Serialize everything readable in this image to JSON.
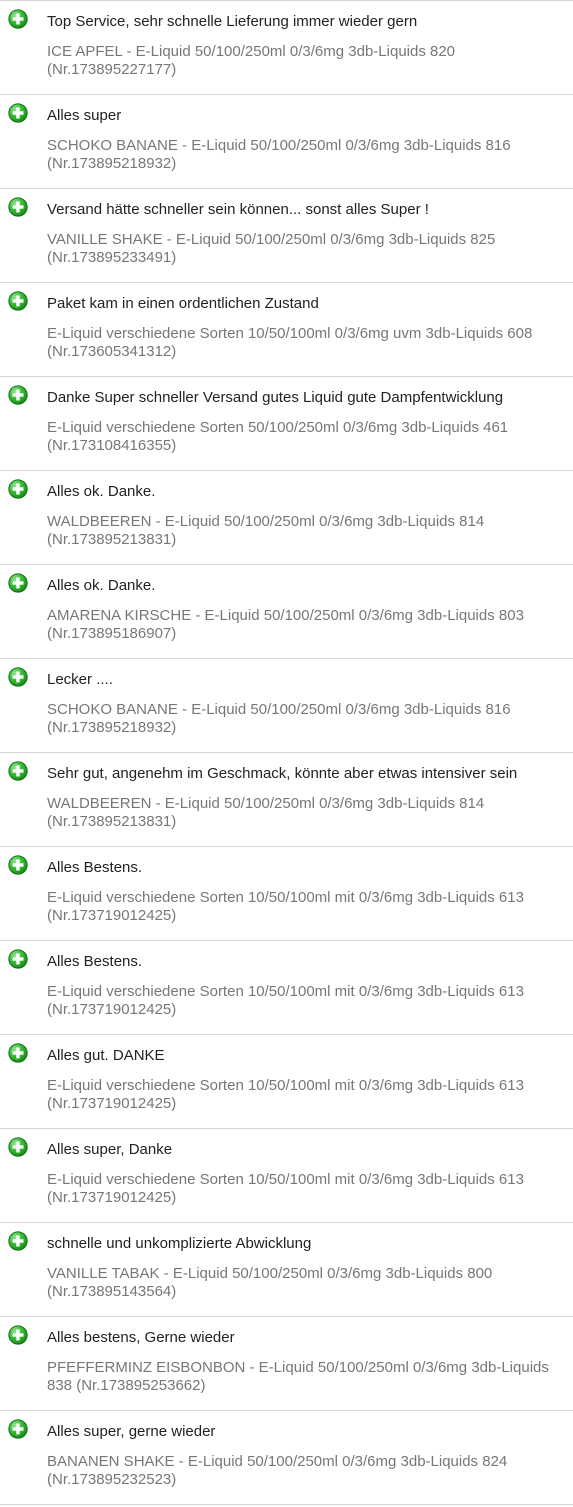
{
  "colors": {
    "positive_icon": "#22aa22",
    "comment_text": "#222222",
    "product_text": "#777777",
    "divider": "#d4d4d4"
  },
  "feedback": [
    {
      "icon": "positive-plus-icon",
      "comment": "Top Service, sehr schnelle Lieferung immer wieder gern",
      "product": "ICE APFEL - E-Liquid 50/100/250ml 0/3/6mg 3db-Liquids 820 (Nr.173895227177)"
    },
    {
      "icon": "positive-plus-icon",
      "comment": "Alles super",
      "product": "SCHOKO BANANE - E-Liquid 50/100/250ml 0/3/6mg 3db-Liquids 816 (Nr.173895218932)"
    },
    {
      "icon": "positive-plus-icon",
      "comment": "Versand hätte schneller sein können... sonst alles Super !",
      "product": "VANILLE SHAKE - E-Liquid 50/100/250ml 0/3/6mg 3db-Liquids 825 (Nr.173895233491)"
    },
    {
      "icon": "positive-plus-icon",
      "comment": "Paket kam in einen ordentlichen Zustand",
      "product": "E-Liquid verschiedene Sorten 10/50/100ml 0/3/6mg uvm 3db-Liquids 608 (Nr.173605341312)"
    },
    {
      "icon": "positive-plus-icon",
      "comment": "Danke Super schneller Versand gutes Liquid gute Dampfentwicklung",
      "product": "E-Liquid verschiedene Sorten 50/100/250ml 0/3/6mg 3db-Liquids 461 (Nr.173108416355)"
    },
    {
      "icon": "positive-plus-icon",
      "comment": "Alles ok. Danke.",
      "product": "WALDBEEREN - E-Liquid 50/100/250ml 0/3/6mg 3db-Liquids 814 (Nr.173895213831)"
    },
    {
      "icon": "positive-plus-icon",
      "comment": "Alles ok. Danke.",
      "product": "AMARENA KIRSCHE - E-Liquid 50/100/250ml 0/3/6mg 3db-Liquids 803 (Nr.173895186907)"
    },
    {
      "icon": "positive-plus-icon",
      "comment": "Lecker ....",
      "product": "SCHOKO BANANE - E-Liquid 50/100/250ml 0/3/6mg 3db-Liquids 816 (Nr.173895218932)"
    },
    {
      "icon": "positive-plus-icon",
      "comment": "Sehr gut, angenehm im Geschmack, könnte aber etwas intensiver sein",
      "product": "WALDBEEREN - E-Liquid 50/100/250ml 0/3/6mg 3db-Liquids 814 (Nr.173895213831)"
    },
    {
      "icon": "positive-plus-icon",
      "comment": "Alles Bestens.",
      "product": "E-Liquid verschiedene Sorten 10/50/100ml mit 0/3/6mg 3db-Liquids 613 (Nr.173719012425)"
    },
    {
      "icon": "positive-plus-icon",
      "comment": "Alles Bestens.",
      "product": "E-Liquid verschiedene Sorten 10/50/100ml mit 0/3/6mg 3db-Liquids 613 (Nr.173719012425)"
    },
    {
      "icon": "positive-plus-icon",
      "comment": "Alles gut. DANKE",
      "product": "E-Liquid verschiedene Sorten 10/50/100ml mit 0/3/6mg 3db-Liquids 613 (Nr.173719012425)"
    },
    {
      "icon": "positive-plus-icon",
      "comment": "Alles super, Danke",
      "product": "E-Liquid verschiedene Sorten 10/50/100ml mit 0/3/6mg 3db-Liquids 613 (Nr.173719012425)"
    },
    {
      "icon": "positive-plus-icon",
      "comment": "schnelle und unkomplizierte Abwicklung",
      "product": "VANILLE TABAK - E-Liquid 50/100/250ml 0/3/6mg 3db-Liquids 800 (Nr.173895143564)"
    },
    {
      "icon": "positive-plus-icon",
      "comment": "Alles bestens, Gerne wieder",
      "product": "PFEFFERMINZ EISBONBON - E-Liquid 50/100/250ml 0/3/6mg 3db-Liquids 838 (Nr.173895253662)"
    },
    {
      "icon": "positive-plus-icon",
      "comment": "Alles super, gerne wieder",
      "product": "BANANEN SHAKE - E-Liquid 50/100/250ml 0/3/6mg 3db-Liquids 824 (Nr.173895232523)"
    }
  ]
}
